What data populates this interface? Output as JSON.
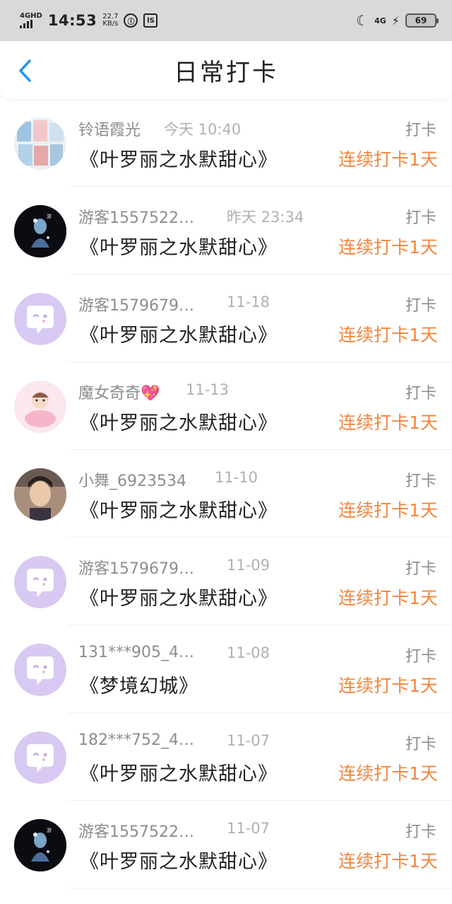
{
  "status_bar": {
    "network": "4GHD",
    "time": "14:53",
    "speed_value": "22.7",
    "speed_unit": "KB/s",
    "icon_1": "ⓛ",
    "icon_2": "lS",
    "net_right": "4G",
    "battery": "69"
  },
  "header": {
    "title": "日常打卡",
    "back_icon": "chevron-left-icon",
    "accent": "#2196f3"
  },
  "colors": {
    "streak": "#f4853d",
    "username": "#8d8d8d",
    "avatar_default": "#d8c9f2"
  },
  "entries": [
    {
      "user": "铃语霞光",
      "time": "今天 10:40",
      "book": "《叶罗丽之水默甜心》",
      "label": "打卡",
      "streak": "连续打卡1天",
      "avatar": "scenic"
    },
    {
      "user": "游客1557522…",
      "time": "昨天 23:34",
      "book": "《叶罗丽之水默甜心》",
      "label": "打卡",
      "streak": "连续打卡1天",
      "avatar": "dark"
    },
    {
      "user": "游客1579679…",
      "time": "11-18",
      "book": "《叶罗丽之水默甜心》",
      "label": "打卡",
      "streak": "连续打卡1天",
      "avatar": "default"
    },
    {
      "user": "魔女奇奇💖",
      "time": "11-13",
      "book": "《叶罗丽之水默甜心》",
      "label": "打卡",
      "streak": "连续打卡1天",
      "avatar": "pink"
    },
    {
      "user": "小舞_6923534",
      "time": "11-10",
      "book": "《叶罗丽之水默甜心》",
      "label": "打卡",
      "streak": "连续打卡1天",
      "avatar": "girl"
    },
    {
      "user": "游客1579679…",
      "time": "11-09",
      "book": "《叶罗丽之水默甜心》",
      "label": "打卡",
      "streak": "连续打卡1天",
      "avatar": "default"
    },
    {
      "user": "131***905_4…",
      "time": "11-08",
      "book": "《梦境幻城》",
      "label": "打卡",
      "streak": "连续打卡1天",
      "avatar": "default"
    },
    {
      "user": "182***752_4…",
      "time": "11-07",
      "book": "《叶罗丽之水默甜心》",
      "label": "打卡",
      "streak": "连续打卡1天",
      "avatar": "default"
    },
    {
      "user": "游客1557522…",
      "time": "11-07",
      "book": "《叶罗丽之水默甜心》",
      "label": "打卡",
      "streak": "连续打卡1天",
      "avatar": "dark"
    }
  ]
}
